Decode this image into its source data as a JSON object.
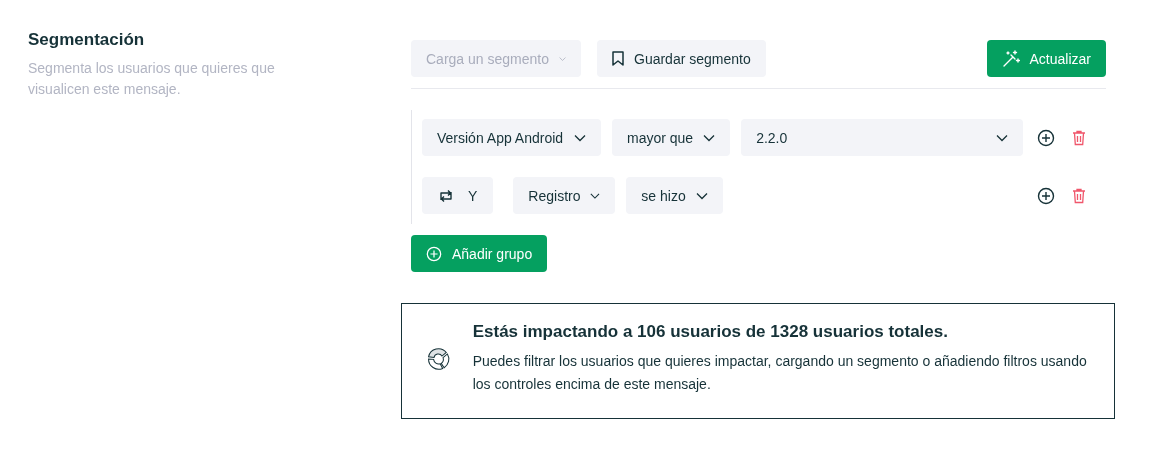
{
  "section": {
    "title": "Segmentación",
    "description": "Segmenta los usuarios que quieres que visualicen este mensaje."
  },
  "toolbar": {
    "segment_select": {
      "placeholder": "Carga un segmento"
    },
    "save_button": "Guardar segmento",
    "update_button": "Actualizar"
  },
  "filters": [
    {
      "kind": "condition",
      "field": "Versión App Android",
      "operator": "mayor que",
      "value": "2.2.0"
    },
    {
      "kind": "conjunction",
      "conjunction": "Y",
      "field": "Registro",
      "operator": "se hizo"
    }
  ],
  "add_group_button": "Añadir grupo",
  "summary": {
    "headline": "Estás impactando a **106** usuarios de **1328** usuarios totales.",
    "body": "Puedes filtrar los usuarios que quieres impactar, cargando un segmento o añadiendo filtros usando los controles encima de este mensaje."
  }
}
